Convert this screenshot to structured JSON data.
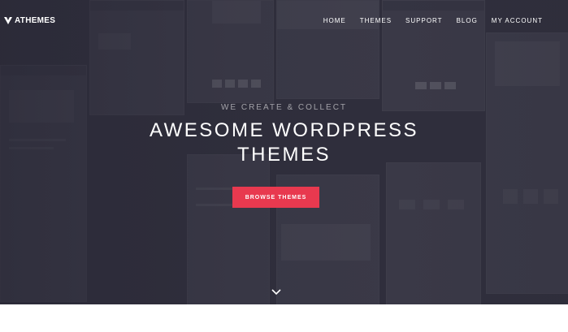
{
  "brand": {
    "name": "ATHEMES",
    "logo_icon": "athemes-logo-icon"
  },
  "nav": {
    "items": [
      "HOME",
      "THEMES",
      "SUPPORT",
      "BLOG",
      "MY ACCOUNT"
    ]
  },
  "hero": {
    "tagline": "WE CREATE & COLLECT",
    "headline_line1": "AWESOME WORDPRESS",
    "headline_line2": "THEMES",
    "cta_label": "BROWSE THEMES",
    "scroll_icon": "chevron-down-icon"
  },
  "colors": {
    "accent": "#e8394f",
    "hero_bg": "#33323f",
    "text": "#ffffff"
  }
}
